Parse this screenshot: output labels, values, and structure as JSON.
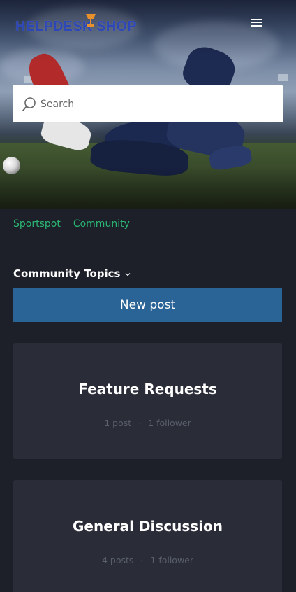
{
  "header": {
    "logo_text": "HELPDESK SHOP",
    "menu_icon": "hamburger-menu-icon",
    "colors": {
      "logo": "#2d47b8",
      "lamp": "#e8912c"
    }
  },
  "search": {
    "placeholder": "Search",
    "icon": "search-icon"
  },
  "breadcrumb": {
    "items": [
      "Sportspot",
      "Community"
    ],
    "color": "#2bb673"
  },
  "topics": {
    "label": "Community Topics",
    "icon": "chevron-down-icon"
  },
  "new_post": {
    "label": "New post",
    "color": "#2a6496"
  },
  "cards": [
    {
      "title": "Feature Requests",
      "posts": "1 post",
      "followers": "1 follower"
    },
    {
      "title": "General Discussion",
      "posts": "4 posts",
      "followers": "1 follower"
    }
  ],
  "separator": "·"
}
